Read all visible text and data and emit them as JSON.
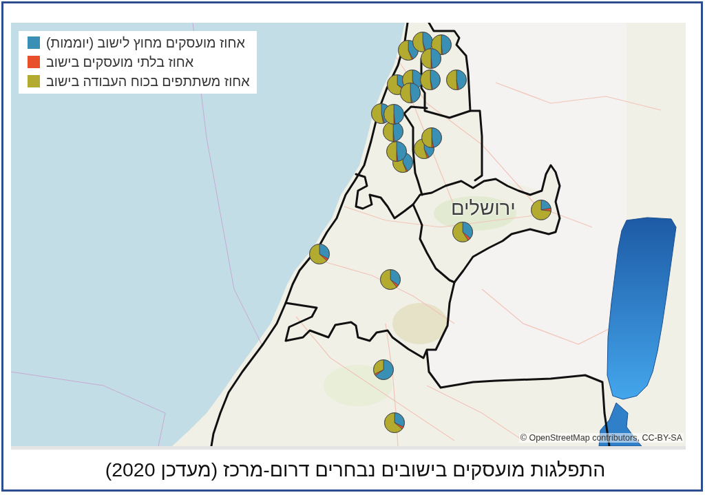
{
  "map": {
    "legend": [
      {
        "label": "אחוז מועסקים מחוץ לישוב (יוממות)",
        "color": "#3a8fb5"
      },
      {
        "label": "אחוז בלתי מועסקים בישוב",
        "color": "#e8502c"
      },
      {
        "label": "אחוז משתתפים בכוח העבודה בישוב",
        "color": "#b3ab2f"
      }
    ],
    "city_label": "ירושלים",
    "attribution": "© OpenStreetMap contributors, CC-BY-SA"
  },
  "caption": "התפלגות מועסקים בישובים נבחרים דרום-מרכז (מעדכן 2020)"
}
